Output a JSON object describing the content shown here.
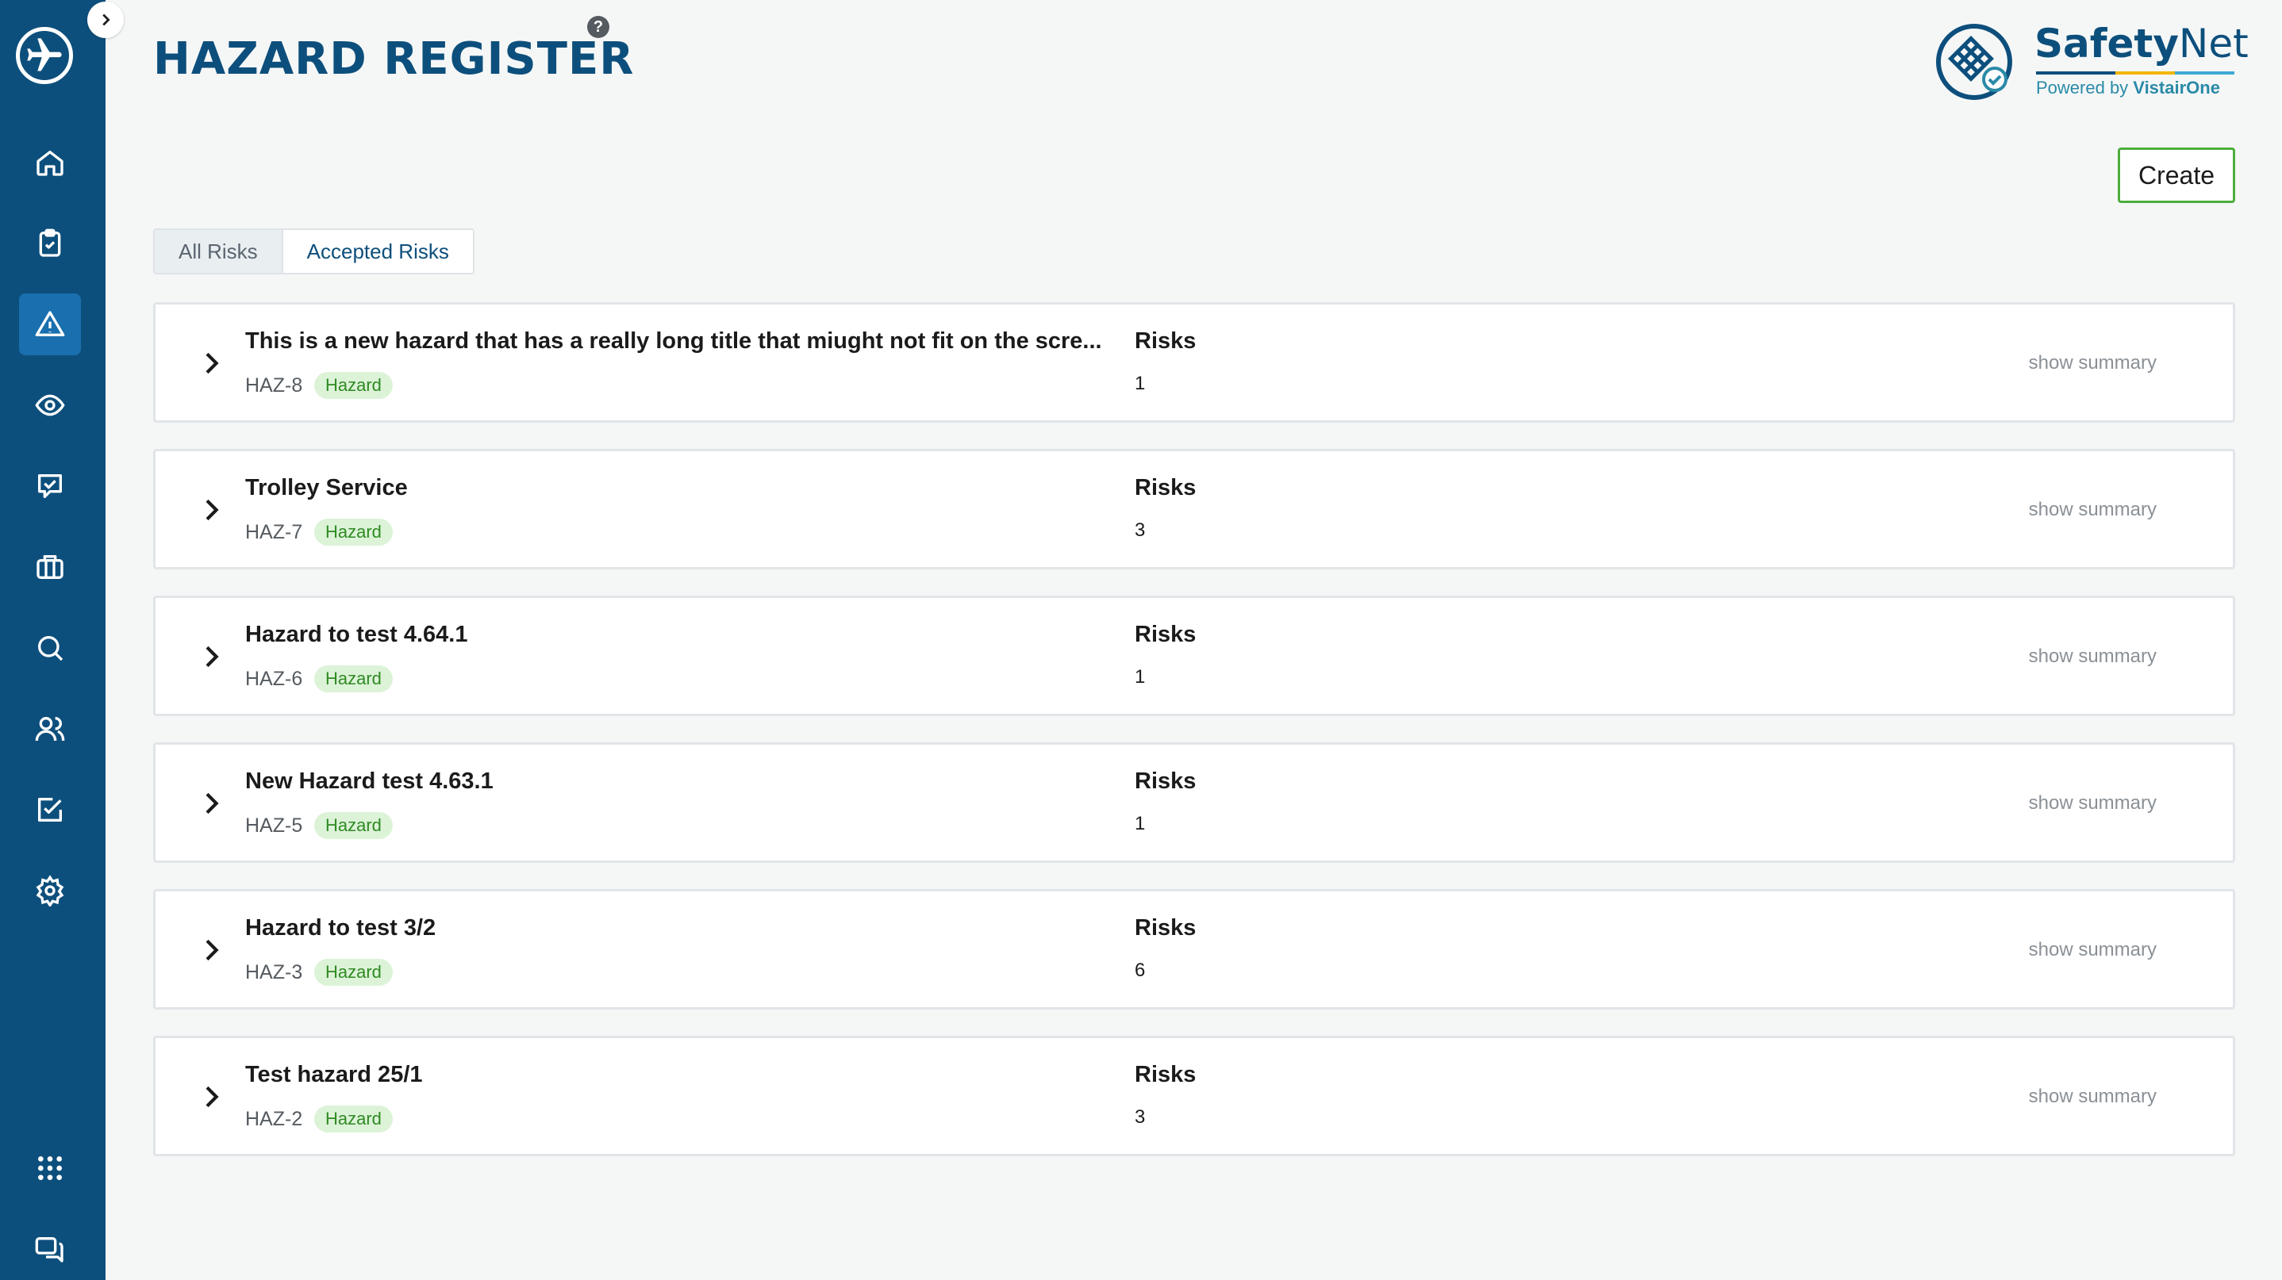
{
  "page": {
    "title": "HAZARD REGISTER",
    "help": "?"
  },
  "brand": {
    "name_bold": "Safety",
    "name_light": "Net",
    "powered_prefix": "Powered by ",
    "powered_name": "VistairOne"
  },
  "actions": {
    "create_label": "Create"
  },
  "tabs": [
    {
      "label": "All Risks",
      "active": true
    },
    {
      "label": "Accepted Risks",
      "active": false
    }
  ],
  "list_labels": {
    "risks": "Risks",
    "summary": "show summary",
    "badge": "Hazard"
  },
  "hazards": [
    {
      "title": "This is a new hazard that has a really long title that miught not fit on the scre...",
      "id": "HAZ-8",
      "risks": "1"
    },
    {
      "title": "Trolley Service",
      "id": "HAZ-7",
      "risks": "3"
    },
    {
      "title": "Hazard to test 4.64.1",
      "id": "HAZ-6",
      "risks": "1"
    },
    {
      "title": "New Hazard test 4.63.1",
      "id": "HAZ-5",
      "risks": "1"
    },
    {
      "title": "Hazard to test 3/2",
      "id": "HAZ-3",
      "risks": "6"
    },
    {
      "title": "Test hazard 25/1",
      "id": "HAZ-2",
      "risks": "3"
    }
  ],
  "sidebar": {
    "items": [
      {
        "icon": "home-icon"
      },
      {
        "icon": "clipboard-check-icon"
      },
      {
        "icon": "warning-icon",
        "active": true
      },
      {
        "icon": "eye-icon"
      },
      {
        "icon": "message-check-icon"
      },
      {
        "icon": "briefcase-icon"
      },
      {
        "icon": "search-icon"
      },
      {
        "icon": "users-icon"
      },
      {
        "icon": "checkbox-edit-icon"
      },
      {
        "icon": "gear-icon"
      },
      {
        "icon": "apps-grid-icon"
      },
      {
        "icon": "chat-bubbles-icon"
      }
    ]
  },
  "colors": {
    "sidebar": "#0d4f7c",
    "accent": "#1a6fae",
    "create_border": "#4cae3b",
    "badge_bg": "#dcf3d8",
    "badge_text": "#2f8a22"
  }
}
